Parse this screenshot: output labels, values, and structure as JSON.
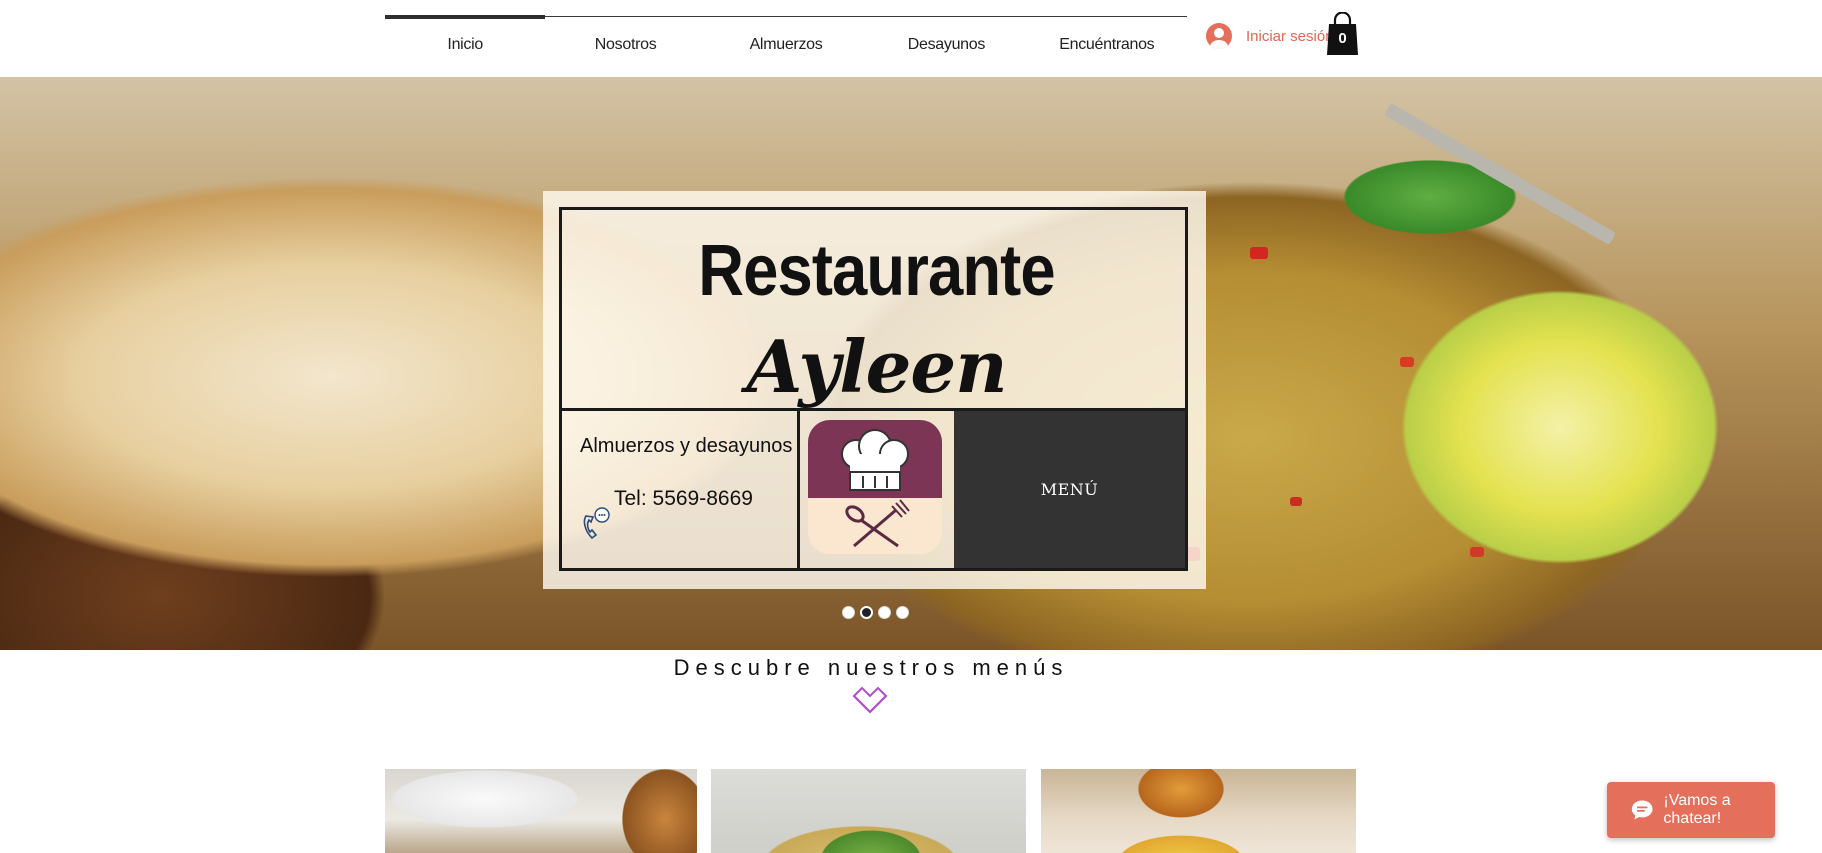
{
  "nav": {
    "items": [
      {
        "label": "Inicio"
      },
      {
        "label": "Nosotros"
      },
      {
        "label": "Almuerzos"
      },
      {
        "label": "Desayunos"
      },
      {
        "label": "Encuéntranos"
      }
    ],
    "active_index": 0
  },
  "account": {
    "login_label": "Iniciar sesión",
    "cart_count": "0"
  },
  "hero": {
    "title": "Restaurante",
    "subtitle": "Ayleen",
    "tagline": "Almuerzos y desayunos",
    "phone": "Tel: 5569-8669",
    "menu_button": "MENÚ",
    "slides_total": 4,
    "active_slide": 2
  },
  "section": {
    "title": "Descubre nuestros menús"
  },
  "chat": {
    "label": "¡Vamos a chatear!"
  },
  "colors": {
    "accent": "#e46f5a",
    "chef_icon_top": "#7d3556",
    "chef_icon_bottom": "#fbe7cf",
    "menu_box": "#333333",
    "chevron": "#b04dc9"
  }
}
